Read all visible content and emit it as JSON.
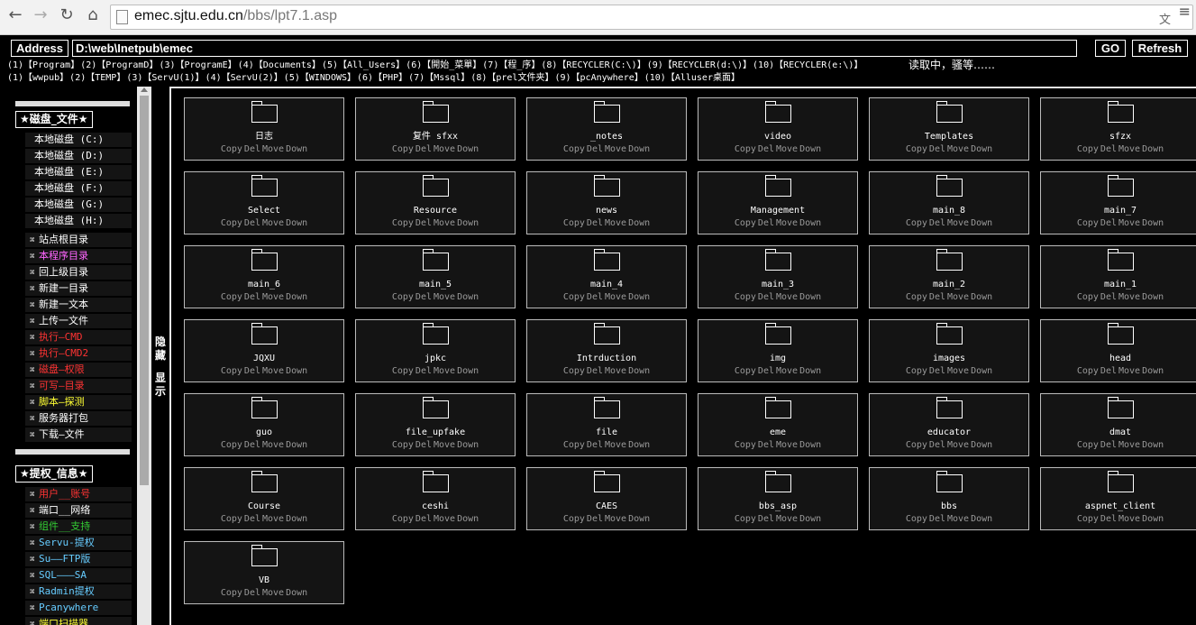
{
  "browser": {
    "url_host": "emec.sjtu.edu.cn",
    "url_path": "/bbs/lpt7.1.asp",
    "back_icon": "←",
    "forward_icon": "→",
    "reload_icon": "↻",
    "home_icon": "⌂",
    "menu_icon": "≡",
    "translate_icon": "文"
  },
  "addressbar": {
    "label": "Address",
    "path": "D:\\web\\Inetpub\\emec",
    "go": "GO",
    "refresh": "Refresh"
  },
  "quicklinks_row1": [
    "(1)【Program】",
    "(2)【ProgramD】",
    "(3)【ProgramE】",
    "(4)【Documents】",
    "(5)【All_Users】",
    "(6)【開始_菜單】",
    "(7)【程_序】",
    "(8)【RECYCLER(C:\\)】",
    "(9)【RECYCLER(d:\\)】",
    "(10)【RECYCLER(e:\\)】"
  ],
  "loading_text": "读取中，骚等……",
  "quicklinks_row2": [
    "(1)【wwpub】",
    "(2)【TEMP】",
    "(3)【ServU(1)】",
    "(4)【ServU(2)】",
    "(5)【WINDOWS】",
    "(6)【PHP】",
    "(7)【Mssql】",
    "(8)【prel文件夹】",
    "(9)【pcAnywhere】",
    "(10)【Alluser桌面】"
  ],
  "sidebar": {
    "section1_title": "★磁盘_文件★",
    "drives": [
      "本地磁盘 (C:)",
      "本地磁盘 (D:)",
      "本地磁盘 (E:)",
      "本地磁盘 (F:)",
      "本地磁盘 (G:)",
      "本地磁盘 (H:)"
    ],
    "tools": [
      {
        "label": "站点根目录",
        "color": "#ffffff"
      },
      {
        "label": "本程序目录",
        "color": "#ff66ff"
      },
      {
        "label": "回上级目录",
        "color": "#ffffff"
      },
      {
        "label": "新建一目录",
        "color": "#ffffff"
      },
      {
        "label": "新建一文本",
        "color": "#ffffff"
      },
      {
        "label": "上传一文件",
        "color": "#ffffff"
      },
      {
        "label": "执行—CMD",
        "color": "#ff3333"
      },
      {
        "label": "执行—CMD2",
        "color": "#ff3333"
      },
      {
        "label": "磁盘—权限",
        "color": "#ff3333"
      },
      {
        "label": "可写—目录",
        "color": "#ff3333"
      },
      {
        "label": "脚本—探测",
        "color": "#ffff33"
      },
      {
        "label": "服务器打包",
        "color": "#ffffff"
      },
      {
        "label": "下载—文件",
        "color": "#ffffff"
      }
    ],
    "section2_title": "★提权_信息★",
    "info_items": [
      {
        "label": "用户__账号",
        "color": "#ff3333"
      },
      {
        "label": "端口__网络",
        "color": "#ffffff"
      },
      {
        "label": "组件__支持",
        "color": "#33cc33"
      },
      {
        "label": "Servu-提权",
        "color": "#66ccff"
      },
      {
        "label": "Su——FTP版",
        "color": "#66ccff"
      },
      {
        "label": "SQL———SA",
        "color": "#66ccff"
      },
      {
        "label": "Radmin提权",
        "color": "#66ccff"
      },
      {
        "label": "Pcanywhere",
        "color": "#66ccff"
      },
      {
        "label": "端口扫描器",
        "color": "#ffff33"
      }
    ]
  },
  "toggle": {
    "hide": "隐藏",
    "show": "显示"
  },
  "action_labels": [
    "Copy",
    "Del",
    "Move",
    "Down"
  ],
  "folders": [
    "日志",
    "复件 sfxx",
    "_notes",
    "video",
    "Templates",
    "sfzx",
    "Select",
    "Resource",
    "news",
    "Management",
    "main_8",
    "main_7",
    "main_6",
    "main_5",
    "main_4",
    "main_3",
    "main_2",
    "main_1",
    "JQXU",
    "jpkc",
    "Intrduction",
    "img",
    "images",
    "head",
    "guo",
    "file_upfake",
    "file",
    "eme",
    "educator",
    "dmat",
    "Course",
    "ceshi",
    "CAES",
    "bbs_asp",
    "bbs",
    "aspnet_client",
    "VB"
  ]
}
